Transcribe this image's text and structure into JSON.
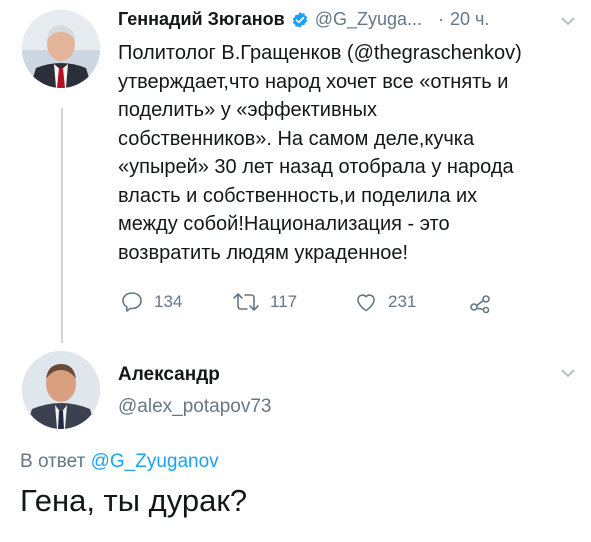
{
  "tweet": {
    "author_name": "Геннадий Зюганов",
    "author_handle": "@G_Zyuga...",
    "separator": "·",
    "time": "20 ч.",
    "text_lines": [
      "Политолог В.Гращенков (@thegraschenkov)",
      "утверждает,что народ хочет все «отнять и",
      "поделить» у «эффективных",
      "собственников». На самом деле,кучка",
      "«упырей» 30 лет назад отобрала у народа",
      "власть и собственность,и поделила их",
      "между собой!Национализация - это",
      "возвратить людям украденное!"
    ],
    "actions": {
      "replies": "134",
      "retweets": "117",
      "likes": "231"
    },
    "icons": {
      "verified": "verified-badge-icon",
      "menu": "chevron-down-icon",
      "reply": "reply-icon",
      "retweet": "retweet-icon",
      "like": "heart-icon",
      "share": "share-icon"
    }
  },
  "reply": {
    "author_name": "Александр",
    "author_handle": "@alex_potapov73",
    "reply_prefix": "В ответ",
    "reply_target": "@G_Zyuganov",
    "text": "Гена, ты дурак?"
  },
  "colors": {
    "accent": "#1da1f2",
    "muted": "#657786",
    "text": "#14171a"
  }
}
